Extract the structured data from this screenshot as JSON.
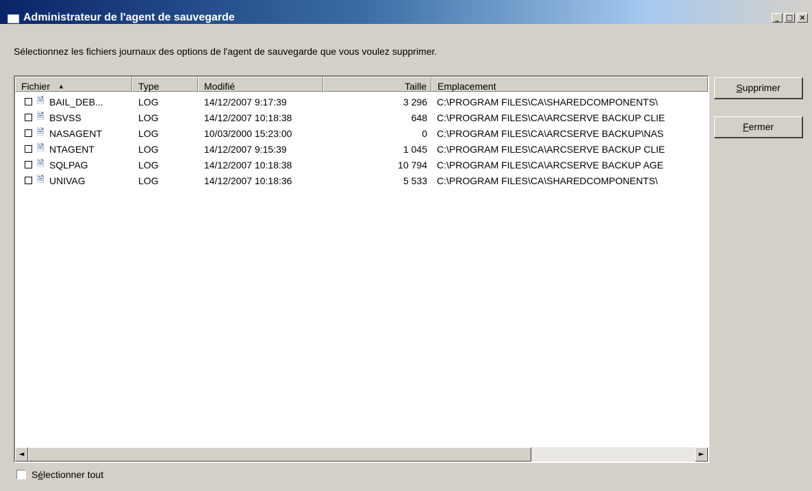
{
  "window": {
    "title": "Administrateur de l'agent de sauvegarde",
    "controls": {
      "minimize": "_",
      "maximize": "□",
      "close": "×"
    }
  },
  "instruction": "Sélectionnez les fichiers journaux des options de l'agent de sauvegarde que vous voulez supprimer.",
  "table": {
    "columns": {
      "fichier": "Fichier",
      "type": "Type",
      "modifie": "Modifié",
      "taille": "Taille",
      "emplacement": "Emplacement"
    },
    "sort_indicator": "▲",
    "rows": [
      {
        "fichier": "BAIL_DEB...",
        "type": "LOG",
        "modifie": "14/12/2007  9:17:39",
        "taille": "3 296",
        "emplacement": "C:\\PROGRAM FILES\\CA\\SHAREDCOMPONENTS\\"
      },
      {
        "fichier": "BSVSS",
        "type": "LOG",
        "modifie": "14/12/2007 10:18:38",
        "taille": "648",
        "emplacement": "C:\\PROGRAM FILES\\CA\\ARCSERVE BACKUP CLIE"
      },
      {
        "fichier": "NASAGENT",
        "type": "LOG",
        "modifie": "10/03/2000 15:23:00",
        "taille": "0",
        "emplacement": "C:\\PROGRAM FILES\\CA\\ARCSERVE BACKUP\\NAS"
      },
      {
        "fichier": "NTAGENT",
        "type": "LOG",
        "modifie": "14/12/2007  9:15:39",
        "taille": "1 045",
        "emplacement": "C:\\PROGRAM FILES\\CA\\ARCSERVE BACKUP CLIE"
      },
      {
        "fichier": "SQLPAG",
        "type": "LOG",
        "modifie": "14/12/2007 10:18:38",
        "taille": "10 794",
        "emplacement": "C:\\PROGRAM FILES\\CA\\ARCSERVE BACKUP AGE"
      },
      {
        "fichier": "UNIVAG",
        "type": "LOG",
        "modifie": "14/12/2007 10:18:36",
        "taille": "5 533",
        "emplacement": "C:\\PROGRAM FILES\\CA\\SHAREDCOMPONENTS\\"
      }
    ],
    "row_icon": "document-icon"
  },
  "buttons": {
    "supprimer": {
      "first": "S",
      "rest": "upprimer"
    },
    "fermer": {
      "first": "F",
      "rest": "ermer"
    }
  },
  "select_all": {
    "pre": "S",
    "ul": "é",
    "post": "lectionner tout",
    "checked": false
  },
  "scrollbar": {
    "left": "◄",
    "right": "►"
  }
}
